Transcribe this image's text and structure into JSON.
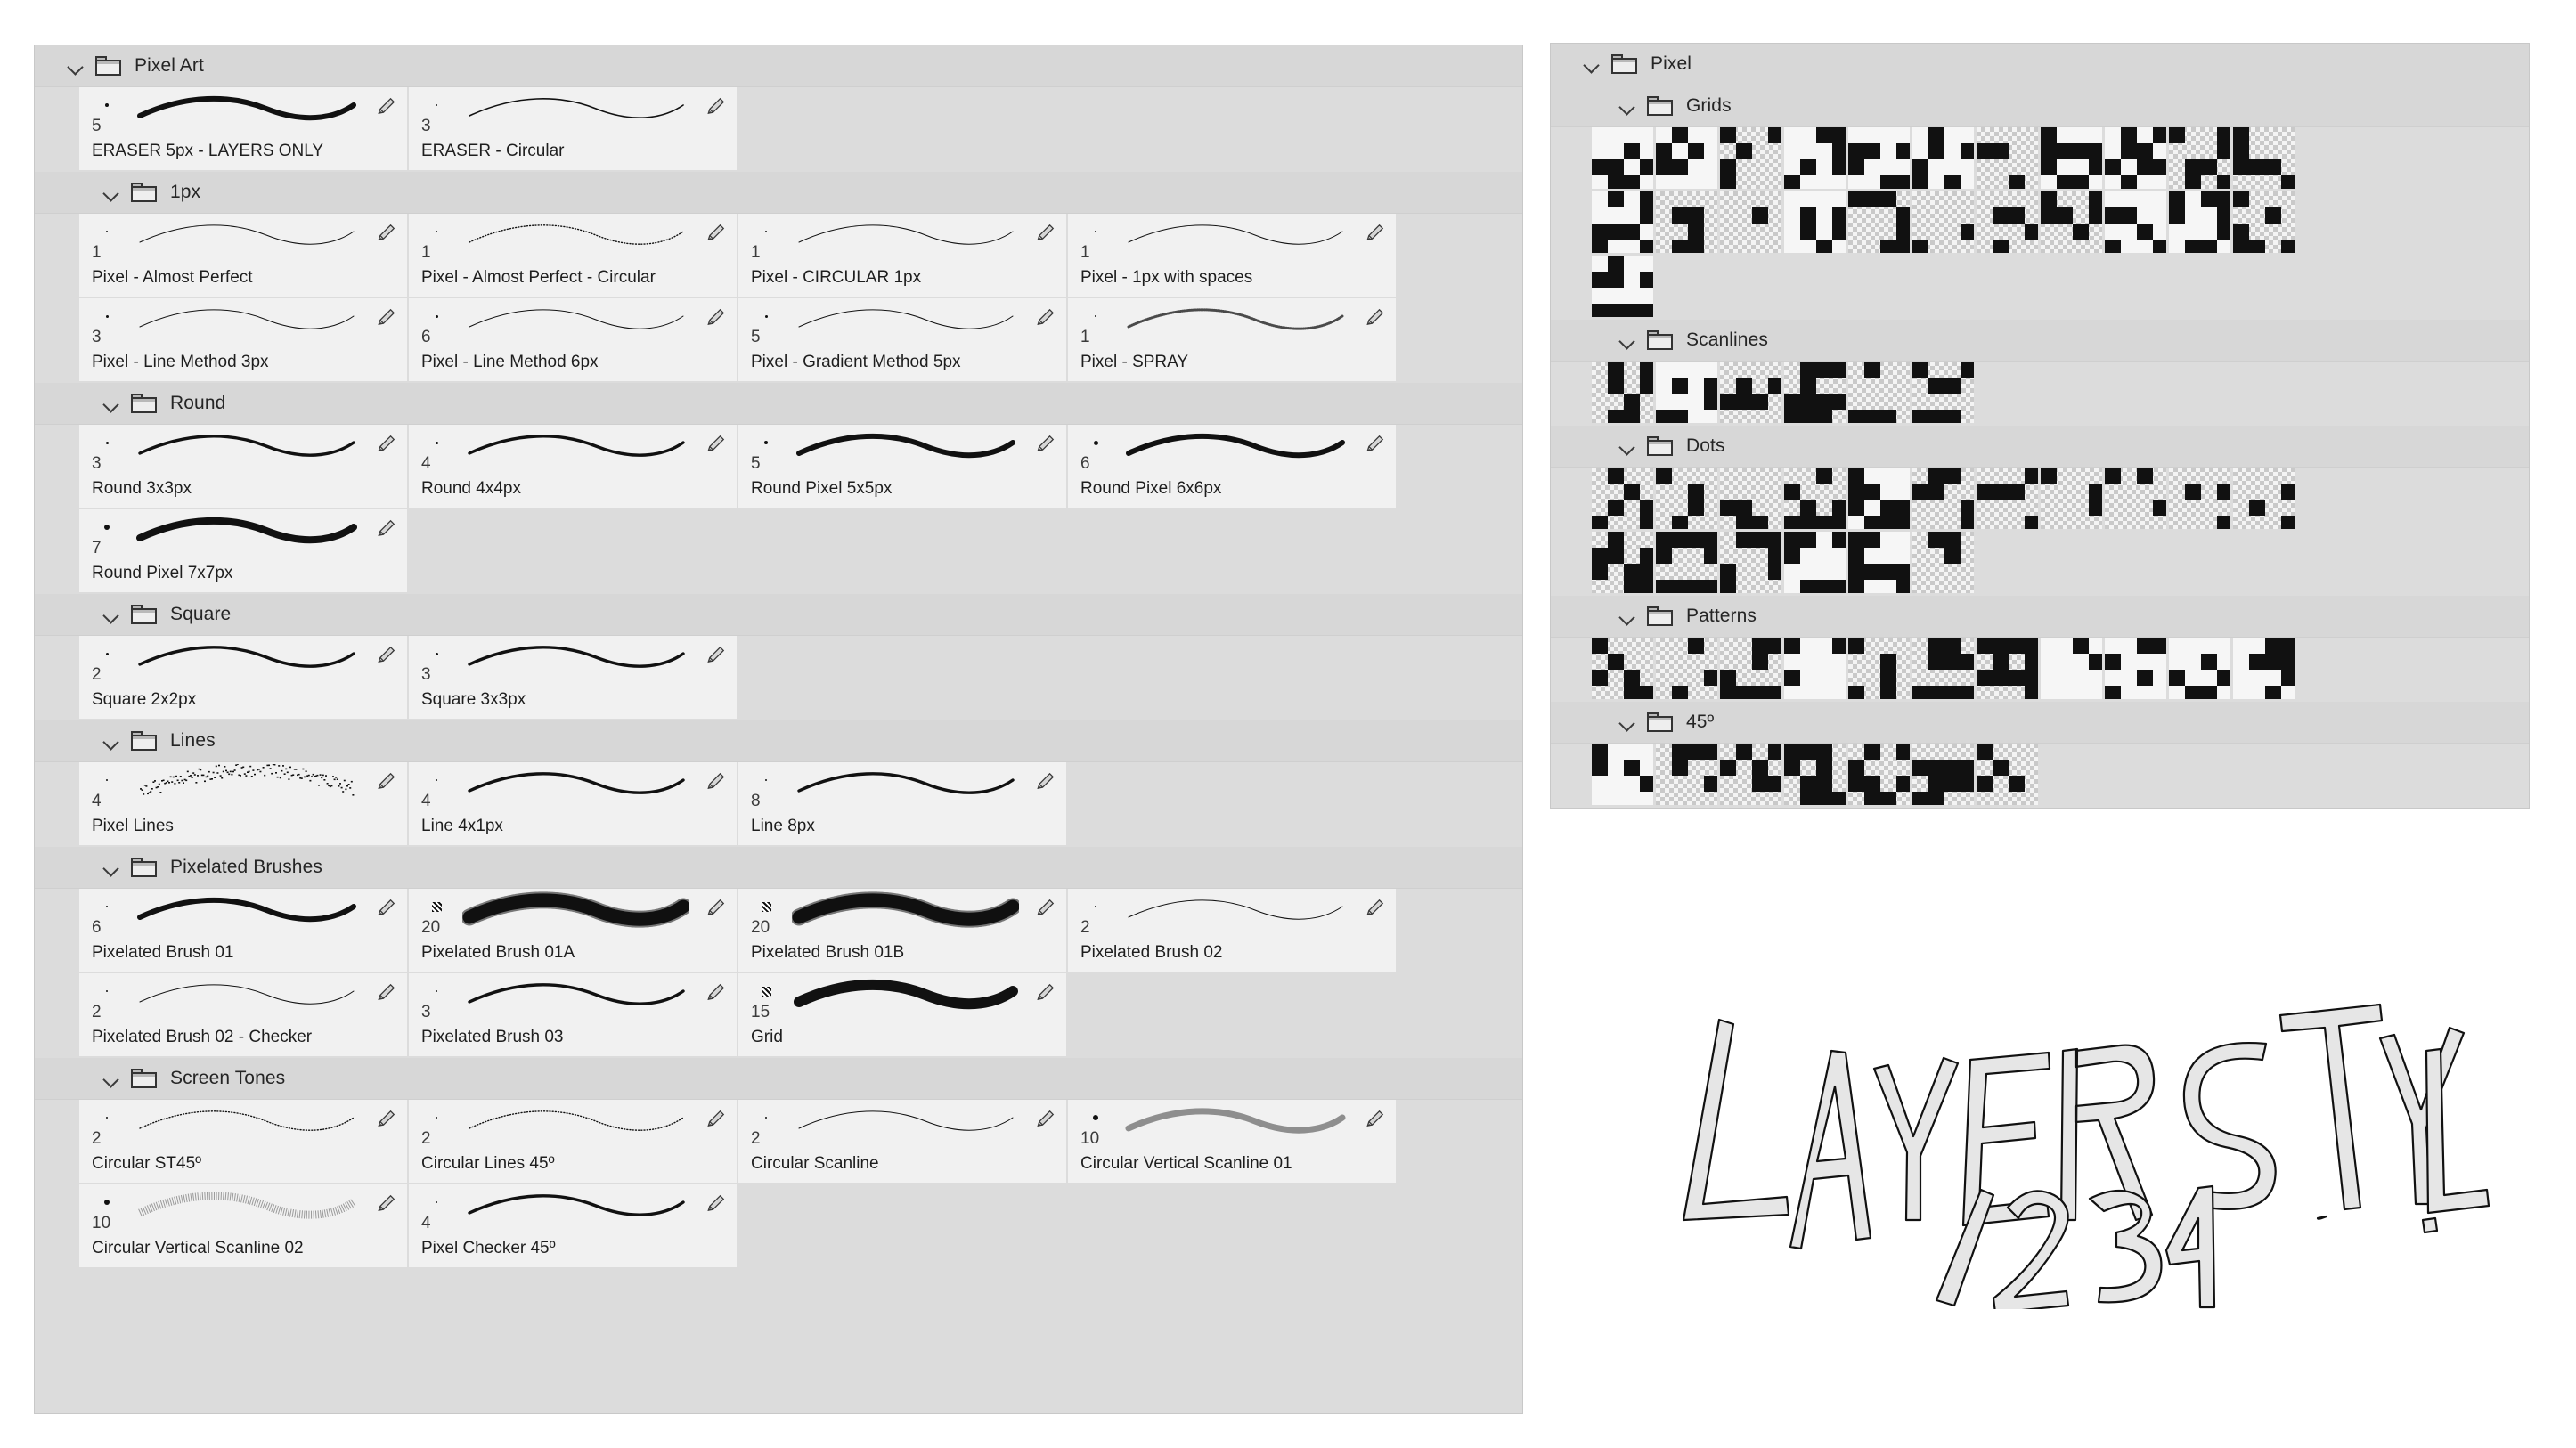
{
  "brush_panel": {
    "name": "brush-presets-panel",
    "groups": [
      {
        "label": "Pixel Art",
        "level": 0,
        "brushes": [
          {
            "size": "5",
            "name": "ERASER 5px - LAYERS ONLY",
            "tip": 4,
            "stroke": "thick",
            "pencil": true
          },
          {
            "size": "3",
            "name": "ERASER - Circular",
            "tip": 2,
            "stroke": "thin",
            "pencil": true
          }
        ]
      },
      {
        "label": "1px",
        "level": 1,
        "brushes": [
          {
            "size": "1",
            "name": "Pixel - Almost Perfect",
            "tip": 2,
            "stroke": "hairline",
            "pencil": true
          },
          {
            "size": "1",
            "name": "Pixel - Almost Perfect - Circular",
            "tip": 2,
            "stroke": "dotted",
            "pencil": true
          },
          {
            "size": "1",
            "name": "Pixel - CIRCULAR 1px",
            "tip": 2,
            "stroke": "hairline",
            "pencil": true
          },
          {
            "size": "1",
            "name": "Pixel - 1px with spaces",
            "tip": 2,
            "stroke": "hairline",
            "pencil": true
          },
          {
            "size": "3",
            "name": "Pixel - Line Method 3px",
            "tip": 3,
            "stroke": "hairline",
            "pencil": true
          },
          {
            "size": "6",
            "name": "Pixel - Line Method 6px",
            "tip": 3,
            "stroke": "hairline",
            "pencil": true
          },
          {
            "size": "5",
            "name": "Pixel - Gradient Method 5px",
            "tip": 3,
            "stroke": "hairline",
            "pencil": true
          },
          {
            "size": "1",
            "name": "Pixel - SPRAY",
            "tip": 2,
            "stroke": "spray",
            "pencil": true
          }
        ]
      },
      {
        "label": "Round",
        "level": 1,
        "brushes": [
          {
            "size": "3",
            "name": "Round 3x3px",
            "tip": 3,
            "stroke": "medium",
            "pencil": true
          },
          {
            "size": "4",
            "name": "Round 4x4px",
            "tip": 3,
            "stroke": "medium",
            "pencil": true
          },
          {
            "size": "5",
            "name": "Round Pixel 5x5px",
            "tip": 4,
            "stroke": "thick",
            "pencil": true
          },
          {
            "size": "6",
            "name": "Round Pixel 6x6px",
            "tip": 5,
            "stroke": "thick",
            "pencil": true
          },
          {
            "size": "7",
            "name": "Round Pixel 7x7px",
            "tip": 6,
            "stroke": "thicker",
            "pencil": true
          }
        ]
      },
      {
        "label": "Square",
        "level": 1,
        "brushes": [
          {
            "size": "2",
            "name": "Square 2x2px",
            "tip": 3,
            "stroke": "medium",
            "pencil": true
          },
          {
            "size": "3",
            "name": "Square 3x3px",
            "tip": 3,
            "stroke": "medium",
            "pencil": true
          }
        ]
      },
      {
        "label": "Lines",
        "level": 1,
        "brushes": [
          {
            "size": "4",
            "name": "Pixel Lines",
            "tip": 2,
            "stroke": "scatter",
            "pencil": true
          },
          {
            "size": "4",
            "name": "Line 4x1px",
            "tip": 2,
            "stroke": "medium",
            "pencil": true
          },
          {
            "size": "8",
            "name": "Line 8px",
            "tip": 2,
            "stroke": "medium",
            "pencil": true
          }
        ]
      },
      {
        "label": "Pixelated Brushes",
        "level": 1,
        "brushes": [
          {
            "size": "6",
            "name": "Pixelated Brush 01",
            "tip": 2,
            "stroke": "thick",
            "pencil": true
          },
          {
            "size": "20",
            "name": "Pixelated Brush 01A",
            "tip": 0,
            "stroke": "fat",
            "pencil": true
          },
          {
            "size": "20",
            "name": "Pixelated Brush 01B",
            "tip": 0,
            "stroke": "fat",
            "pencil": true
          },
          {
            "size": "2",
            "name": "Pixelated Brush 02",
            "tip": 2,
            "stroke": "hairline",
            "pencil": true
          },
          {
            "size": "2",
            "name": "Pixelated Brush 02 - Checker",
            "tip": 2,
            "stroke": "hairline",
            "pencil": true
          },
          {
            "size": "3",
            "name": "Pixelated Brush 03",
            "tip": 2,
            "stroke": "medium",
            "pencil": true
          },
          {
            "size": "15",
            "name": "Grid",
            "tip": 0,
            "stroke": "verythick",
            "pencil": true
          }
        ]
      },
      {
        "label": "Screen Tones",
        "level": 1,
        "brushes": [
          {
            "size": "2",
            "name": "Circular ST45º",
            "tip": 2,
            "stroke": "dotted",
            "pencil": true
          },
          {
            "size": "2",
            "name": "Circular Lines 45º",
            "tip": 2,
            "stroke": "dotted",
            "pencil": true
          },
          {
            "size": "2",
            "name": "Circular Scanline",
            "tip": 2,
            "stroke": "hairline",
            "pencil": true
          },
          {
            "size": "10",
            "name": "Circular Vertical Scanline 01",
            "tip": 6,
            "stroke": "gray",
            "pencil": true
          },
          {
            "size": "10",
            "name": "Circular Vertical Scanline 02",
            "tip": 6,
            "stroke": "hatch",
            "pencil": true
          },
          {
            "size": "4",
            "name": "Pixel Checker 45º",
            "tip": 2,
            "stroke": "medium",
            "pencil": true
          }
        ]
      }
    ]
  },
  "pattern_panel": {
    "name": "pattern-presets-panel",
    "root_label": "Pixel",
    "groups": [
      {
        "label": "Grids",
        "level": 2,
        "rows": [
          11,
          11,
          1
        ]
      },
      {
        "label": "Scanlines",
        "level": 2,
        "rows": [
          6
        ]
      },
      {
        "label": "Dots",
        "level": 2,
        "rows": [
          11,
          6
        ]
      },
      {
        "label": "Patterns",
        "level": 2,
        "rows": [
          11
        ]
      },
      {
        "label": "45º",
        "level": 2,
        "rows": [
          7
        ]
      }
    ]
  },
  "handwriting": {
    "line1": "LAYER STYLE",
    "line2": "1234"
  },
  "colors": {
    "panel_bg": "#dcdcdc",
    "header_bg": "#d7d7d7",
    "cell_bg": "#f1f1f1",
    "text": "#1e1e1e",
    "stroke": "#111111"
  }
}
